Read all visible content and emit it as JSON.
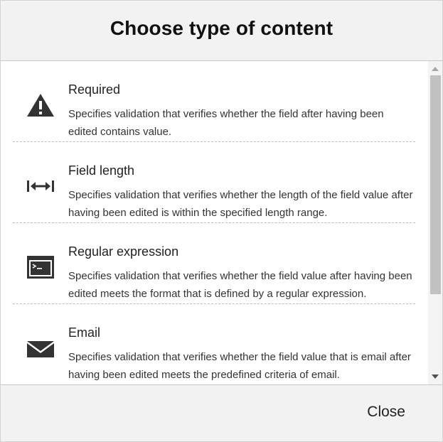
{
  "dialog": {
    "title": "Choose type of content",
    "close_label": "Close"
  },
  "items": [
    {
      "icon": "warning-icon",
      "title": "Required",
      "description": "Specifies validation that verifies whether the field after having been edited contains value."
    },
    {
      "icon": "field-length-icon",
      "title": "Field length",
      "description": "Specifies validation that verifies whether the length of the field value after having been edited is within the specified length range."
    },
    {
      "icon": "terminal-icon",
      "title": "Regular expression",
      "description": "Specifies validation that verifies whether the field value after having been edited meets the format that is defined by a regular expression."
    },
    {
      "icon": "envelope-icon",
      "title": "Email",
      "description": "Specifies validation that verifies whether the field value that is email after having been edited meets the predefined criteria of email."
    }
  ],
  "colors": {
    "header_bg": "#f2f2f2",
    "icon": "#333333",
    "scroll_thumb": "#c1c1c1"
  }
}
